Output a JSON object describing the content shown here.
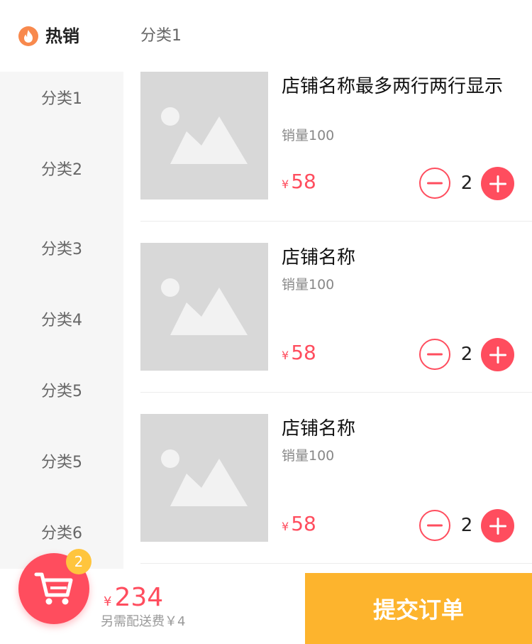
{
  "sidebar": {
    "hot_label": "热销",
    "items": [
      "分类1",
      "分类2",
      "分类3",
      "分类4",
      "分类5",
      "分类5",
      "分类6"
    ]
  },
  "main": {
    "category_title": "分类1",
    "products": [
      {
        "name": "店铺名称最多两行两行显示",
        "sales": "销量100",
        "currency": "¥",
        "price": "58",
        "quantity": "2"
      },
      {
        "name": "店铺名称",
        "sales": "销量100",
        "currency": "¥",
        "price": "58",
        "quantity": "2"
      },
      {
        "name": "店铺名称",
        "sales": "销量100",
        "currency": "¥",
        "price": "58",
        "quantity": "2"
      }
    ]
  },
  "cart": {
    "badge_count": "2",
    "currency": "¥",
    "total": "234",
    "delivery_note": "另需配送费￥4",
    "submit_label": "提交订单"
  },
  "colors": {
    "accent": "#ff4d5e",
    "submit": "#fdb42d",
    "badge": "#ffc53d",
    "fire": "#f8894d"
  },
  "icons": {
    "hot": "fire-icon",
    "cart": "shopping-cart-icon",
    "minus": "minus-icon",
    "plus": "plus-icon",
    "thumbnail": "image-placeholder-icon"
  }
}
